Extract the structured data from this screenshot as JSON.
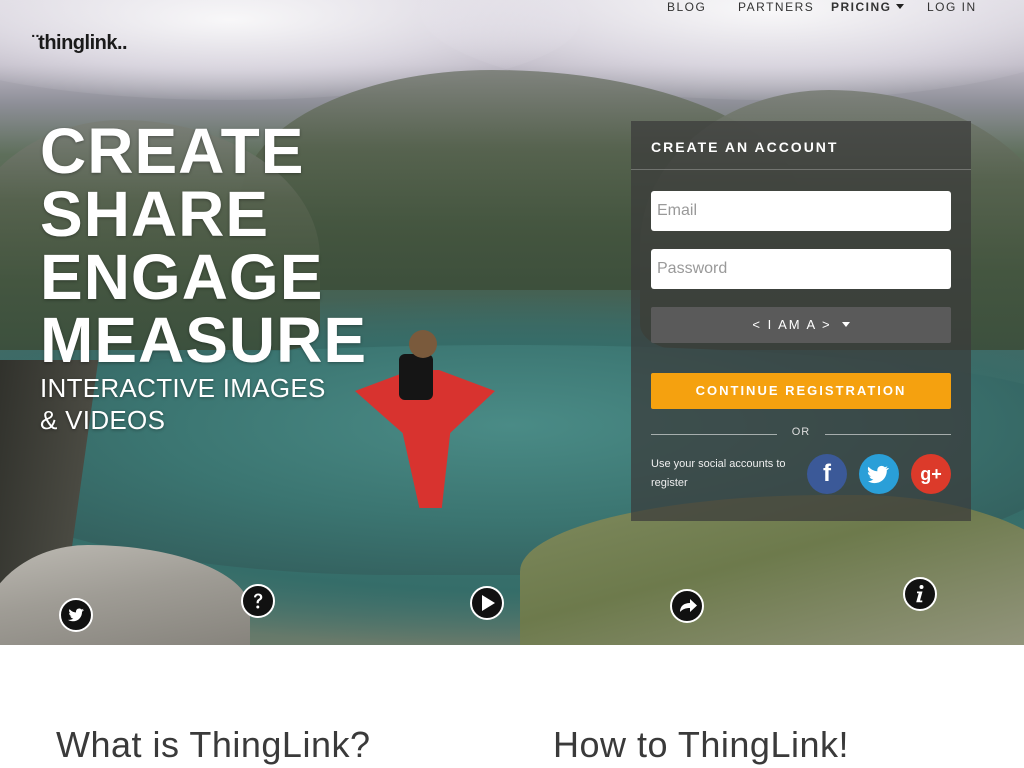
{
  "brand": {
    "logo_text": "¨thinglink.."
  },
  "nav": {
    "items": [
      {
        "label": "BLOG"
      },
      {
        "label": "PARTNERS"
      },
      {
        "label": "PRICING"
      },
      {
        "label": "LOG IN"
      }
    ]
  },
  "hero": {
    "headline": [
      "CREATE",
      "SHARE",
      "ENGAGE",
      "MEASURE"
    ],
    "subline": [
      "INTERACTIVE IMAGES",
      "& VIDEOS"
    ]
  },
  "signup": {
    "title": "CREATE AN ACCOUNT",
    "email_placeholder": "Email",
    "password_placeholder": "Password",
    "role_select_label": "< I AM A >",
    "continue_label": "CONTINUE REGISTRATION",
    "or_label": "OR",
    "social_prompt": "Use your social accounts to register",
    "social": {
      "facebook_glyph": "f",
      "twitter_glyph": "♥",
      "google_glyph": "g+"
    }
  },
  "hotspots": [
    {
      "icon": "twitter-icon"
    },
    {
      "icon": "question-icon"
    },
    {
      "icon": "play-icon"
    },
    {
      "icon": "share-arrow-icon"
    },
    {
      "icon": "info-icon"
    }
  ],
  "sections": {
    "what_title": "What is ThingLink?",
    "how_title": "How to ThingLink!"
  },
  "colors": {
    "accent_orange": "#f5a10f",
    "facebook_blue": "#3b5998",
    "twitter_blue": "#2a9fd8",
    "google_red": "#dc3a2a",
    "panel_dark": "#3a3a3a"
  }
}
